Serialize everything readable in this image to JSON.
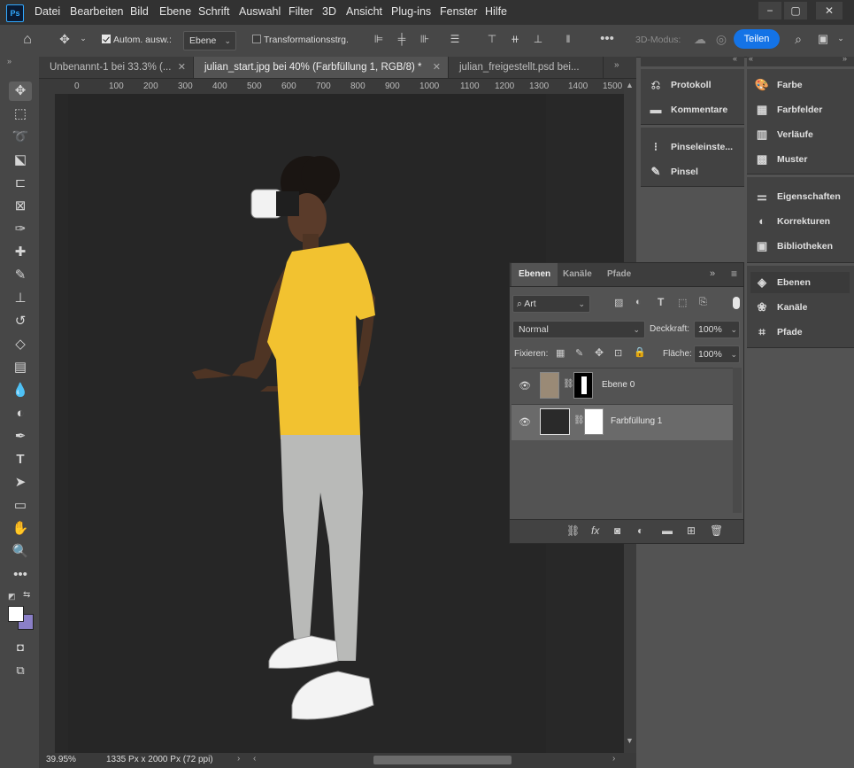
{
  "app": {
    "logo": "Ps"
  },
  "menu": [
    "Datei",
    "Bearbeiten",
    "Bild",
    "Ebene",
    "Schrift",
    "Auswahl",
    "Filter",
    "3D",
    "Ansicht",
    "Plug-ins",
    "Fenster",
    "Hilfe"
  ],
  "options": {
    "auto_select_label": "Autom. ausw.:",
    "auto_select_checked": true,
    "auto_select_target": "Ebene",
    "transform_controls_label": "Transformationsstrg.",
    "transform_controls_checked": false,
    "mode_3d_label": "3D-Modus:",
    "share_label": "Teilen"
  },
  "tabs": [
    {
      "label": "Unbenannt-1 bei 33.3% (...",
      "active": false
    },
    {
      "label": "julian_start.jpg bei 40% (Farbfüllung 1, RGB/8) *",
      "active": true
    },
    {
      "label": "julian_freigestellt.psd bei...",
      "active": false
    }
  ],
  "ruler": {
    "ticks": [
      "0",
      "100",
      "200",
      "300",
      "400",
      "500",
      "600",
      "700",
      "800",
      "900",
      "1000",
      "1100",
      "1200",
      "1300",
      "1400",
      "1500"
    ]
  },
  "status": {
    "zoom": "39.95%",
    "doc_info": "1335 Px x 2000 Px (72 ppi)"
  },
  "dock_middle": {
    "group1": [
      {
        "label": "Protokoll",
        "icon": "history-icon"
      },
      {
        "label": "Kommentare",
        "icon": "comment-icon"
      }
    ],
    "group2": [
      {
        "label": "Pinseleinste...",
        "icon": "brush-settings-icon"
      },
      {
        "label": "Pinsel",
        "icon": "brush-icon"
      }
    ]
  },
  "dock_right": {
    "group1": [
      {
        "label": "Farbe",
        "icon": "palette-icon"
      },
      {
        "label": "Farbfelder",
        "icon": "swatches-icon"
      },
      {
        "label": "Verläufe",
        "icon": "gradient-icon"
      },
      {
        "label": "Muster",
        "icon": "pattern-icon"
      }
    ],
    "group2": [
      {
        "label": "Eigenschaften",
        "icon": "properties-icon"
      },
      {
        "label": "Korrekturen",
        "icon": "adjustments-icon"
      },
      {
        "label": "Bibliotheken",
        "icon": "libraries-icon"
      }
    ],
    "group3": [
      {
        "label": "Ebenen",
        "icon": "layers-icon",
        "active": true
      },
      {
        "label": "Kanäle",
        "icon": "channels-icon"
      },
      {
        "label": "Pfade",
        "icon": "paths-icon"
      }
    ]
  },
  "layers_panel": {
    "tabs": [
      "Ebenen",
      "Kanäle",
      "Pfade"
    ],
    "filter_kind": "Art",
    "blend_mode": "Normal",
    "opacity_label": "Deckkraft:",
    "opacity_value": "100%",
    "lock_label": "Fixieren:",
    "fill_label": "Fläche:",
    "fill_value": "100%",
    "layers": [
      {
        "name": "Ebene 0",
        "visible": true,
        "selected": false
      },
      {
        "name": "Farbfüllung 1",
        "visible": true,
        "selected": true
      }
    ]
  },
  "colors": {
    "accent": "#1473e6",
    "canvas_fill": "#282828",
    "shirt": "#f2c230",
    "background_swatch": "#8a7fc7"
  }
}
